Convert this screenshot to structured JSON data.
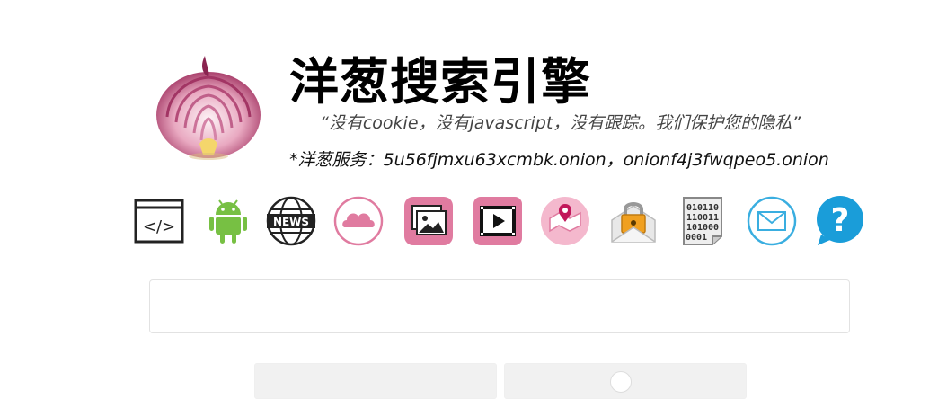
{
  "header": {
    "title": "洋葱搜索引擎",
    "tagline": "“没有cookie，没有javascript，没有跟踪。我们保护您的隐私”",
    "services": "*洋葱服务：5u56fjmxu63xcmbk.onion，onionf4j3fwqpeo5.onion"
  },
  "logo": {
    "icon": "onion-logo-icon"
  },
  "icons": [
    {
      "name": "code-icon"
    },
    {
      "name": "android-icon"
    },
    {
      "name": "news-icon"
    },
    {
      "name": "cloud-icon"
    },
    {
      "name": "images-icon"
    },
    {
      "name": "video-icon"
    },
    {
      "name": "map-icon"
    },
    {
      "name": "secure-mail-icon"
    },
    {
      "name": "binary-file-icon"
    },
    {
      "name": "mail-icon"
    },
    {
      "name": "help-icon"
    }
  ],
  "search": {
    "value": "",
    "placeholder": ""
  },
  "colors": {
    "accent_pink": "#e07ba0",
    "android_green": "#77c043",
    "help_blue": "#1a9dd9",
    "mail_blue": "#3aaee0"
  }
}
